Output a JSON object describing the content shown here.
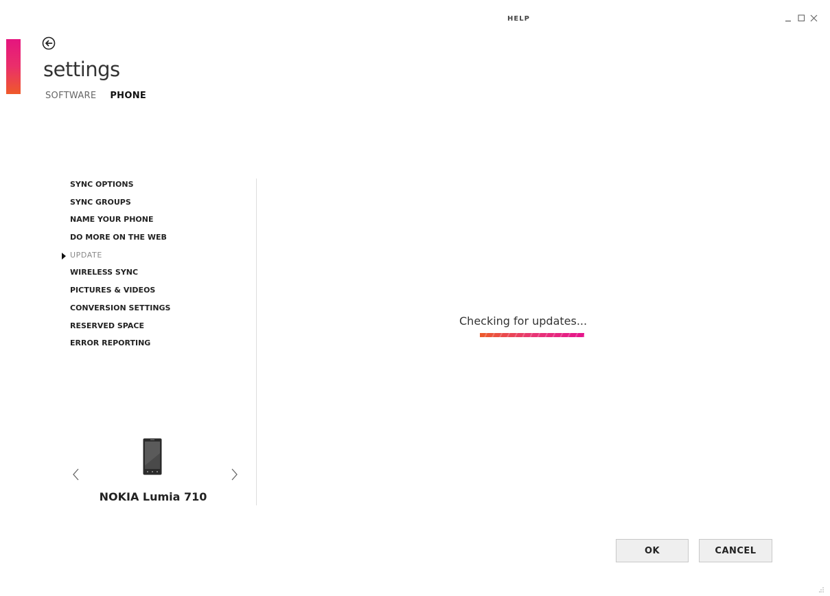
{
  "header": {
    "help_label": "HELP",
    "window_controls": {
      "minimize": "_",
      "maximize": "□",
      "close": "×"
    }
  },
  "page": {
    "title": "settings",
    "pivot": [
      {
        "label": "SOFTWARE",
        "active": false
      },
      {
        "label": "PHONE",
        "active": true
      }
    ]
  },
  "nav": {
    "items": [
      {
        "label": "SYNC OPTIONS"
      },
      {
        "label": "SYNC GROUPS"
      },
      {
        "label": "NAME YOUR PHONE"
      },
      {
        "label": "DO MORE ON THE WEB"
      },
      {
        "label": "UPDATE",
        "selected": true
      },
      {
        "label": "WIRELESS SYNC"
      },
      {
        "label": "PICTURES & VIDEOS"
      },
      {
        "label": "CONVERSION SETTINGS"
      },
      {
        "label": "RESERVED SPACE"
      },
      {
        "label": "ERROR REPORTING"
      }
    ]
  },
  "device": {
    "name": "NOKIA Lumia 710",
    "prev_icon": "chevron-left-icon",
    "next_icon": "chevron-right-icon"
  },
  "main": {
    "status_text": "Checking for updates...",
    "progress_state": "indeterminate"
  },
  "footer": {
    "ok_label": "OK",
    "cancel_label": "CANCEL"
  },
  "colors": {
    "accent_top": "#e5157f",
    "accent_bottom": "#ef5a2a"
  }
}
